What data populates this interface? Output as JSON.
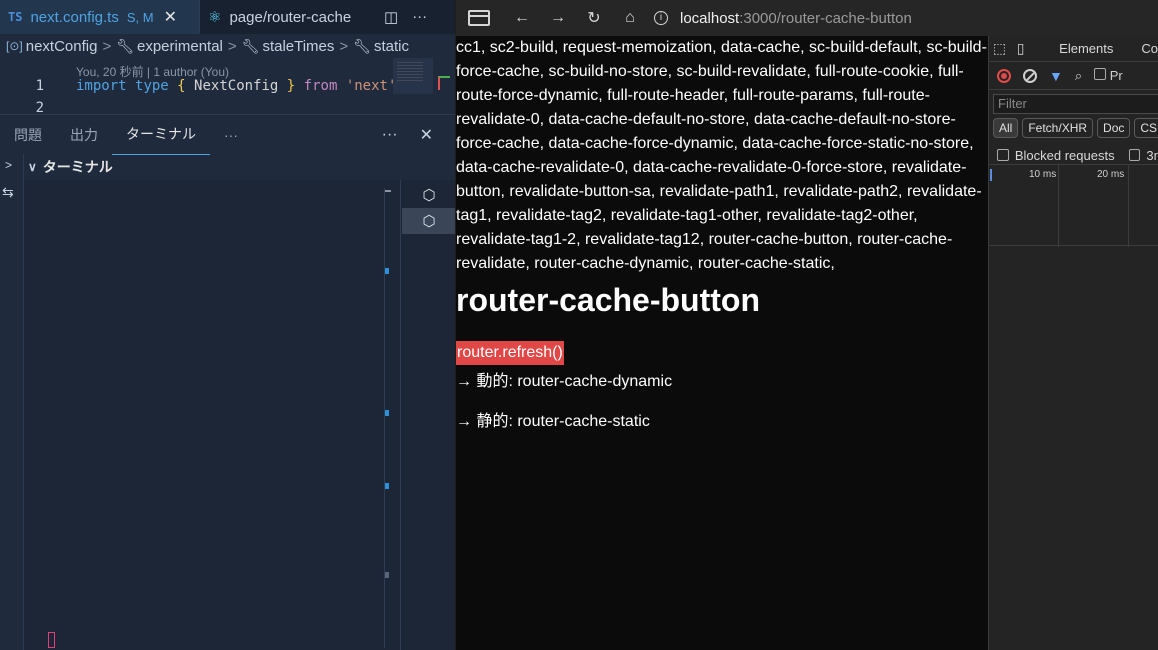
{
  "vscode": {
    "tabs": [
      {
        "badge": "TS",
        "name": "next.config.ts",
        "status": "S, M",
        "close": "✕"
      },
      {
        "name": "page/router-cache"
      }
    ],
    "breadcrumb": [
      "nextConfig",
      "experimental",
      "staleTimes",
      "static"
    ],
    "blame": "You, 20 秒前 | 1 author (You)",
    "code": {
      "line1_no": "1",
      "line2_no": "2",
      "kw_import": "import",
      "kw_type": "type",
      "brace_open": "{",
      "type_name": "NextConfig",
      "brace_close": "}",
      "kw_from": "from",
      "str": "'next'"
    },
    "panel_tabs": [
      "問題",
      "出力",
      "ターミナル"
    ],
    "panel_more": "···",
    "panel_close": "✕",
    "terminal_header": "ターミナル"
  },
  "browser": {
    "url_host": "localhost",
    "url_path": ":3000/router-cache-button",
    "links_text": "cc1, sc2-build, request-memoization, data-cache, sc-build-default, sc-build-force-cache, sc-build-no-store, sc-build-revalidate, full-route-cookie, full-route-force-dynamic, full-route-header, full-route-params, full-route-revalidate-0, data-cache-default-no-store, data-cache-default-no-store-force-cache, data-cache-force-dynamic, data-cache-force-static-no-store, data-cache-revalidate-0, data-cache-revalidate-0-force-store, revalidate-button, revalidate-button-sa, revalidate-path1, revalidate-path2, revalidate-tag1, revalidate-tag2, revalidate-tag1-other, revalidate-tag2-other, revalidate-tag1-2, revalidate-tag12, router-cache-button, router-cache-revalidate, router-cache-dynamic, router-cache-static,",
    "heading": "router-cache-button",
    "refresh_button": "router.refresh()",
    "link_dynamic": "→ 動的: router-cache-dynamic",
    "link_static": "→ 静的: router-cache-static"
  },
  "devtools": {
    "tab_elements": "Elements",
    "tab_console": "Co",
    "preserve": "Pr",
    "filter_placeholder": "Filter",
    "types": [
      "All",
      "Fetch/XHR",
      "Doc",
      "CS"
    ],
    "blocked": "Blocked requests",
    "third": "3r",
    "tl_10": "10 ms",
    "tl_20": "20 ms"
  },
  "colors": {
    "accent": "#4fa3e3",
    "button_red": "#e04747",
    "record_red": "#e24a4a"
  }
}
